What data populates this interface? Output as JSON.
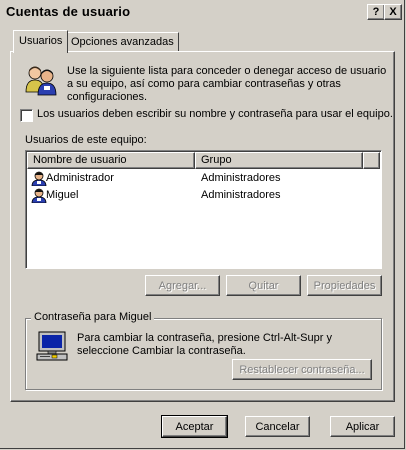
{
  "window": {
    "title": "Cuentas de usuario",
    "help_label": "?",
    "close_label": "X"
  },
  "tabs": [
    {
      "label": "Usuarios",
      "selected": true
    },
    {
      "label": "Opciones avanzadas",
      "selected": false
    }
  ],
  "intro": {
    "text_line1": "Use la siguiente lista para conceder o denegar acceso de usuario",
    "text_line2": "a su equipo, así como para cambiar contraseñas y otras",
    "text_line3": "configuraciones."
  },
  "require_login_checkbox": {
    "label": "Los usuarios deben escribir su nombre y contraseña para usar el equipo.",
    "checked": false
  },
  "users_list": {
    "label": "Usuarios de este equipo:",
    "columns": [
      "Nombre de usuario",
      "Grupo"
    ],
    "rows": [
      {
        "name": "Administrador",
        "group": "Administradores"
      },
      {
        "name": "Miguel",
        "group": "Administradores"
      }
    ]
  },
  "list_buttons": {
    "add": "Agregar...",
    "remove": "Quitar",
    "properties": "Propiedades"
  },
  "password_group": {
    "title": "Contraseña para Miguel",
    "text_line1": "Para cambiar la contraseña, presione Ctrl-Alt-Supr y",
    "text_line2": "seleccione Cambiar la contraseña.",
    "reset_button": "Restablecer contraseña..."
  },
  "dialog_buttons": {
    "ok": "Aceptar",
    "cancel": "Cancelar",
    "apply": "Aplicar"
  },
  "icons": {
    "users": "users-icon",
    "user": "user-icon",
    "computer": "computer-icon"
  },
  "colors": {
    "face": "#d4d0c8",
    "shadow": "#808080",
    "highlight": "#ffffff"
  }
}
